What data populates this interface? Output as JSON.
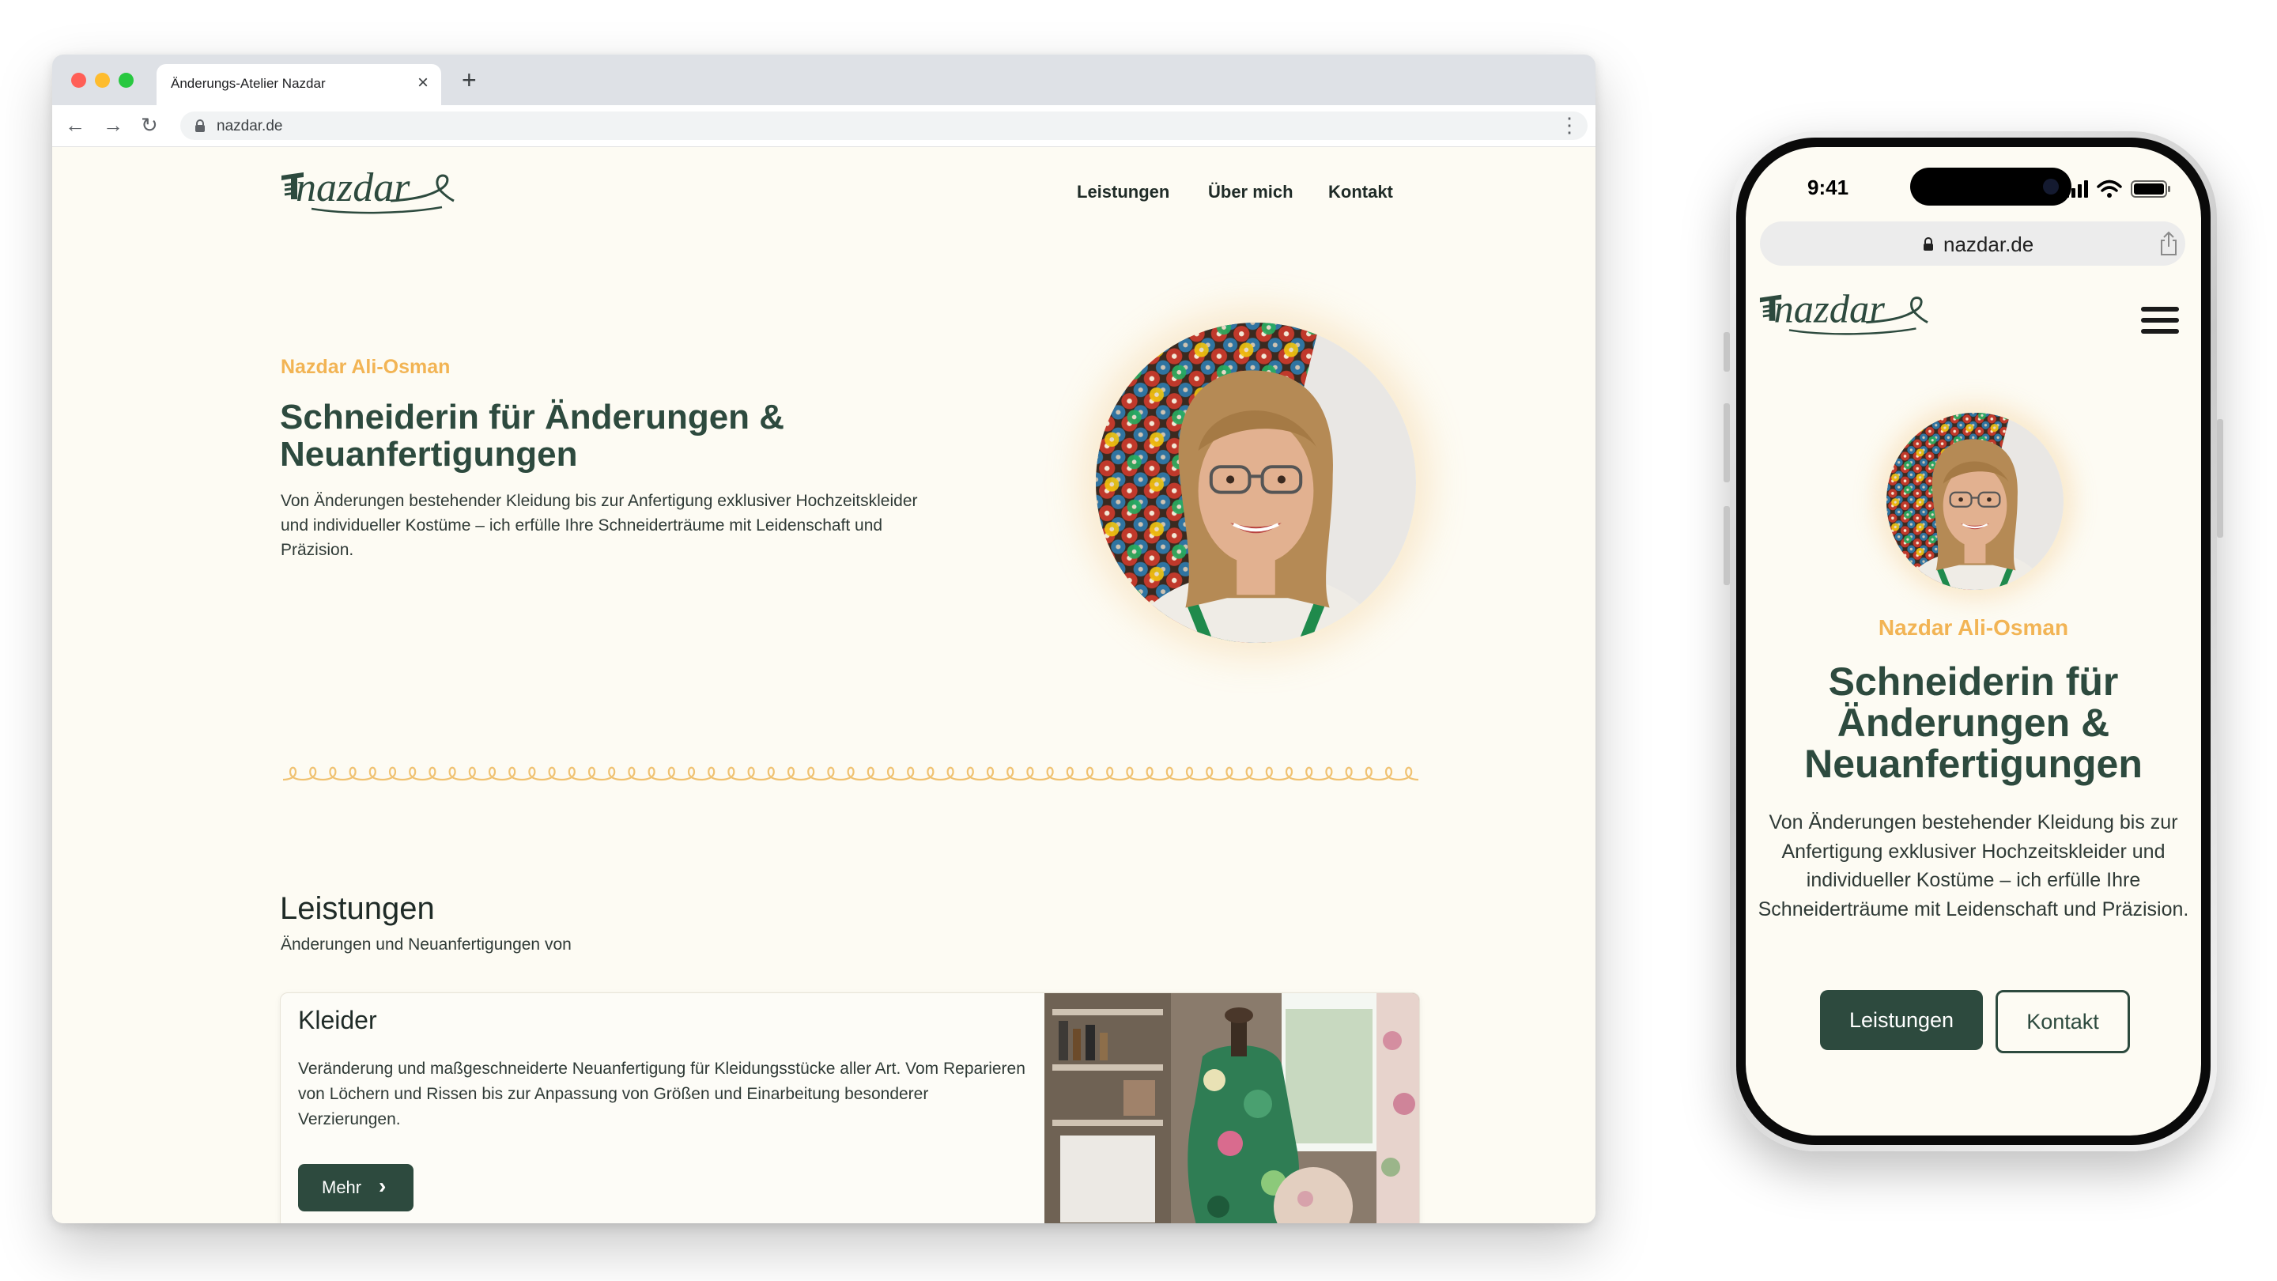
{
  "browser": {
    "tab_title": "Änderungs-Atelier Nazdar",
    "tab_close": "×",
    "new_tab": "+",
    "url": "nazdar.de",
    "back_icon": "←",
    "forward_icon": "→",
    "reload_icon": "↻",
    "menu_icon": "⋮",
    "traffic_colors": [
      "#ff5f57",
      "#febc2e",
      "#28c840"
    ]
  },
  "site": {
    "logo_alt": "nazdar",
    "nav": [
      "Leistungen",
      "Über mich",
      "Kontakt"
    ],
    "hero": {
      "eyebrow": "Nazdar Ali-Osman",
      "title": "Schneiderin für Änderungen & Neuanfertigungen",
      "text": "Von Änderungen bestehender Kleidung bis zur Anfertigung exklusiver Hochzeitskleider und individueller Kostüme – ich erfülle Ihre Schneiderträume mit Leidenschaft und Präzision."
    },
    "services": {
      "title": "Leistungen",
      "subtitle": "Änderungen und Neuanfertigungen von",
      "cards": [
        {
          "title": "Kleider",
          "text": "Veränderung und maßgeschneiderte Neuanfertigung für Kleidungsstücke aller Art. Vom Reparieren von Löchern und Rissen bis zur Anpassung von Größen und Einarbeitung besonderer Verzierungen.",
          "button": "Mehr",
          "button_icon": "›"
        }
      ]
    }
  },
  "phone": {
    "time": "9:41",
    "url": "nazdar.de",
    "buttons": {
      "primary": "Leistungen",
      "secondary": "Kontakt"
    }
  },
  "colors": {
    "brand_green": "#2d4a3e",
    "accent_gold": "#f2b454",
    "page_bg": "#fdfbf3"
  }
}
